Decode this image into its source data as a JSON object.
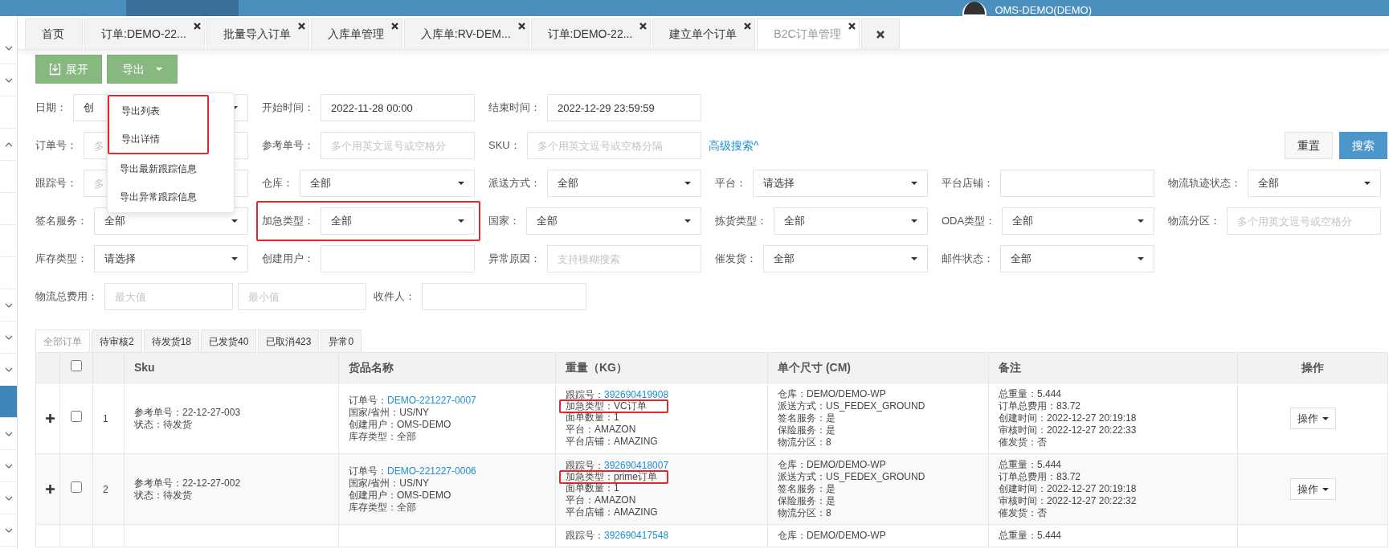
{
  "top_bar": {
    "user_name": "OMS-DEMO(DEMO)"
  },
  "sidebar": {
    "items": [
      {
        "kind": "group",
        "expanded": false,
        "selected": false
      },
      {
        "kind": "group",
        "expanded": false,
        "selected": false
      },
      {
        "kind": "entry",
        "selected": false
      },
      {
        "kind": "group",
        "expanded": true,
        "selected": false
      },
      {
        "kind": "entry",
        "selected": false
      },
      {
        "kind": "entry",
        "selected": false
      },
      {
        "kind": "entry",
        "selected": false
      },
      {
        "kind": "entry",
        "selected": false
      },
      {
        "kind": "group",
        "expanded": false,
        "selected": false
      },
      {
        "kind": "group",
        "expanded": false,
        "selected": false
      },
      {
        "kind": "group",
        "expanded": false,
        "selected": false
      },
      {
        "kind": "entry",
        "selected": true
      },
      {
        "kind": "group",
        "expanded": false,
        "selected": false
      },
      {
        "kind": "group",
        "expanded": false,
        "selected": false
      },
      {
        "kind": "group",
        "expanded": false,
        "selected": false
      },
      {
        "kind": "group",
        "expanded": false,
        "selected": false
      }
    ]
  },
  "tabs": [
    {
      "kind": "page",
      "label": "首页",
      "closable": false,
      "selected": false
    },
    {
      "kind": "page",
      "label": "订单:DEMO-22...",
      "closable": true,
      "selected": false
    },
    {
      "kind": "page",
      "label": "批量导入订单",
      "closable": true,
      "selected": false
    },
    {
      "kind": "page",
      "label": "入库单管理",
      "closable": true,
      "selected": false
    },
    {
      "kind": "page",
      "label": "入库单:RV-DEM...",
      "closable": true,
      "selected": false
    },
    {
      "kind": "page",
      "label": "订单:DEMO-22...",
      "closable": true,
      "selected": false
    },
    {
      "kind": "page",
      "label": "建立单个订单",
      "closable": true,
      "selected": false
    },
    {
      "kind": "page",
      "label": "B2C订单管理",
      "closable": true,
      "selected": true
    },
    {
      "kind": "close-all",
      "selected": false
    }
  ],
  "toolbar": {
    "buttons": [
      {
        "kind": "icon",
        "label": "展开"
      },
      {
        "kind": "dropdown",
        "label": "导出"
      }
    ],
    "menu": {
      "items": [
        {
          "label": "导出列表",
          "highlighted": true
        },
        {
          "label": "导出详情",
          "highlighted": true
        },
        {
          "label": "导出最新跟踪信息",
          "highlighted": false
        },
        {
          "label": "导出异常跟踪信息",
          "highlighted": false
        }
      ]
    }
  },
  "filters": {
    "rows": [
      {
        "fields": [
          {
            "kind": "select",
            "label": "日期：",
            "value": "创",
            "highlighted": false
          },
          {
            "kind": "input",
            "label": "开始时间：",
            "value": "2022-11-28 00:00",
            "highlighted": false
          },
          {
            "kind": "input",
            "label": "结束时间：",
            "value": "2022-12-29 23:59:59",
            "highlighted": false
          }
        ]
      },
      {
        "fields": [
          {
            "kind": "input",
            "label": "订单号：",
            "placeholder": "多",
            "highlighted": false
          },
          {
            "kind": "input",
            "label": "参考单号：",
            "placeholder": "多个用英文逗号或空格分",
            "highlighted": false
          },
          {
            "kind": "input",
            "label": "SKU：",
            "placeholder": "多个用英文逗号或空格分隔",
            "highlighted": false
          }
        ],
        "link": "高级搜索^",
        "buttons": [
          {
            "kind": "default",
            "label": "重置"
          },
          {
            "kind": "primary",
            "label": "搜索"
          }
        ]
      },
      {
        "fields": [
          {
            "kind": "input",
            "label": "跟踪号：",
            "placeholder": "多",
            "highlighted": false
          },
          {
            "kind": "select",
            "label": "仓库：",
            "value": "全部",
            "highlighted": false
          },
          {
            "kind": "select",
            "label": "派送方式：",
            "value": "全部",
            "highlighted": false
          },
          {
            "kind": "select",
            "label": "平台：",
            "value": "请选择",
            "highlighted": false
          },
          {
            "kind": "input",
            "label": "平台店铺：",
            "highlighted": false
          },
          {
            "kind": "select",
            "label": "物流轨迹状态：",
            "value": "全部",
            "highlighted": false
          }
        ]
      },
      {
        "fields": [
          {
            "kind": "select",
            "label": "签名服务：",
            "value": "全部",
            "highlighted": false
          },
          {
            "kind": "select",
            "label": "加急类型：",
            "value": "全部",
            "highlighted": true
          },
          {
            "kind": "select",
            "label": "国家：",
            "value": "全部",
            "highlighted": false
          },
          {
            "kind": "select",
            "label": "拣货类型：",
            "value": "全部",
            "highlighted": false
          },
          {
            "kind": "select",
            "label": "ODA类型：",
            "value": "全部",
            "highlighted": false
          },
          {
            "kind": "input",
            "label": "物流分区：",
            "placeholder": "多个用英文逗号或空格分",
            "highlighted": false
          }
        ]
      },
      {
        "fields": [
          {
            "kind": "select",
            "label": "库存类型：",
            "value": "请选择",
            "highlighted": false
          },
          {
            "kind": "input",
            "label": "创建用户：",
            "highlighted": false
          },
          {
            "kind": "input",
            "label": "异常原因：",
            "placeholder": "支持模糊搜索",
            "highlighted": false
          },
          {
            "kind": "select",
            "label": "催发货：",
            "value": "全部",
            "highlighted": false
          },
          {
            "kind": "select",
            "label": "邮件状态：",
            "value": "全部",
            "highlighted": false
          }
        ]
      },
      {
        "fields": [
          {
            "kind": "range",
            "label": "物流总费用：",
            "placeholders": [
              "最大值",
              "最小值"
            ],
            "highlighted": false
          },
          {
            "kind": "input",
            "label": "收件人：",
            "highlighted": false
          }
        ]
      }
    ]
  },
  "order_tabs": [
    {
      "label": "全部订单",
      "selected": true
    },
    {
      "label": "待审核2",
      "selected": false
    },
    {
      "label": "待发货18",
      "selected": false
    },
    {
      "label": "已发货40",
      "selected": false
    },
    {
      "label": "已取消423",
      "selected": false
    },
    {
      "label": "异常0",
      "selected": false
    }
  ],
  "table": {
    "select_all_checked": false,
    "columns": [
      "Sku",
      "货品名称",
      "重量（KG）",
      "单个尺寸 (CM)",
      "备注",
      "操作"
    ],
    "rows": [
      {
        "expandable": true,
        "checked": false,
        "index": "1",
        "sku": [
          {
            "text": "参考单号：22-12-27-003"
          },
          {
            "text": "状态：待发货"
          }
        ],
        "goods": [
          {
            "text": "订单号：",
            "link": "DEMO-221227-0007"
          },
          {
            "text": "国家/省州：US/NY"
          },
          {
            "text": "创建用户：OMS-DEMO"
          },
          {
            "text": "库存类型：全部"
          }
        ],
        "weight": [
          {
            "text": "跟踪号：",
            "link": "392690419908",
            "highlighted": false
          },
          {
            "text": "加急类型：VC订单",
            "highlighted": true
          },
          {
            "text": "面单数量：1",
            "highlighted": false
          },
          {
            "text": "平台：AMAZON",
            "highlighted": false
          },
          {
            "text": "平台店铺：AMAZING",
            "highlighted": false
          }
        ],
        "size": [
          {
            "text": "仓库：DEMO/DEMO-WP"
          },
          {
            "text": "派送方式：US_FEDEX_GROUND"
          },
          {
            "text": "签名服务：是"
          },
          {
            "text": "保险服务：是"
          },
          {
            "text": "物流分区：8"
          }
        ],
        "notes": [
          {
            "text": "总重量：5.444"
          },
          {
            "text": "订单总费用：83.72"
          },
          {
            "text": "创建时间：2022-12-27 20:19:18"
          },
          {
            "text": "审核时间：2022-12-27 20:22:33"
          },
          {
            "text": "催发货：否"
          }
        ],
        "action": "操作"
      },
      {
        "expandable": true,
        "checked": false,
        "index": "2",
        "sku": [
          {
            "text": "参考单号：22-12-27-002"
          },
          {
            "text": "状态：待发货"
          }
        ],
        "goods": [
          {
            "text": "订单号：",
            "link": "DEMO-221227-0006"
          },
          {
            "text": "国家/省州：US/NY"
          },
          {
            "text": "创建用户：OMS-DEMO"
          },
          {
            "text": "库存类型：全部"
          }
        ],
        "weight": [
          {
            "text": "跟踪号：",
            "link": "392690418007",
            "highlighted": false
          },
          {
            "text": "加急类型：prime订单",
            "highlighted": true
          },
          {
            "text": "面单数量：1",
            "highlighted": false
          },
          {
            "text": "平台：AMAZON",
            "highlighted": false
          },
          {
            "text": "平台店铺：AMAZING",
            "highlighted": false
          }
        ],
        "size": [
          {
            "text": "仓库：DEMO/DEMO-WP"
          },
          {
            "text": "派送方式：US_FEDEX_GROUND"
          },
          {
            "text": "签名服务：是"
          },
          {
            "text": "保险服务：是"
          },
          {
            "text": "物流分区：8"
          }
        ],
        "notes": [
          {
            "text": "总重量：5.444"
          },
          {
            "text": "订单总费用：83.72"
          },
          {
            "text": "创建时间：2022-12-27 20:19:18"
          },
          {
            "text": "审核时间：2022-12-27 20:22:32"
          },
          {
            "text": "催发货：否"
          }
        ],
        "action": "操作"
      },
      {
        "weight": [
          {
            "text": "跟踪号：",
            "link": "392690417548",
            "highlighted": false
          }
        ],
        "size": [
          {
            "text": "仓库：DEMO/DEMO-WP"
          }
        ],
        "notes": [
          {
            "text": "总重量：5.444"
          }
        ]
      }
    ]
  }
}
